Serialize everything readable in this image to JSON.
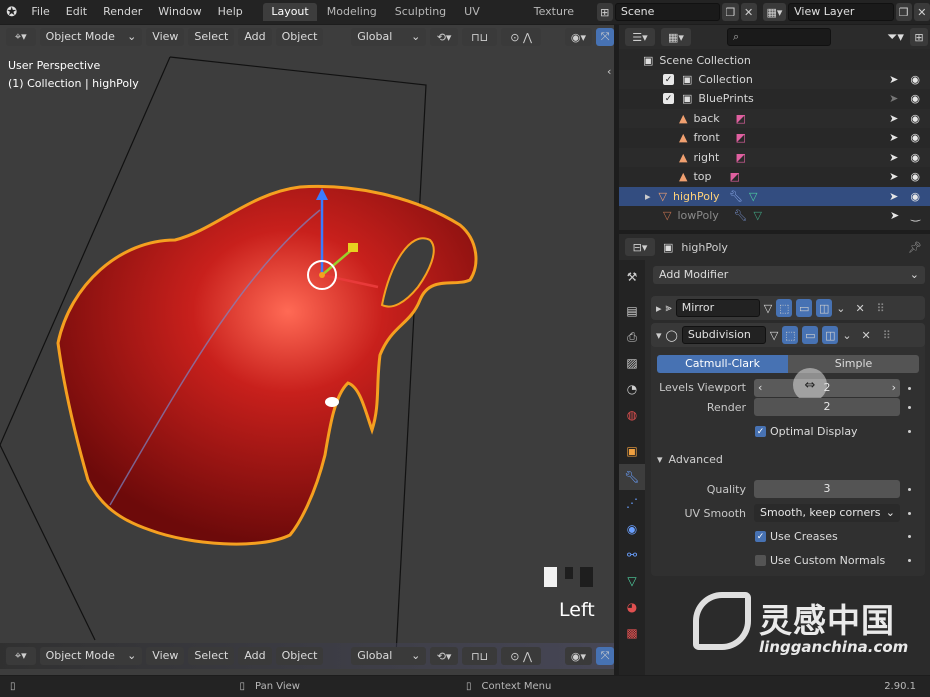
{
  "topbar": {
    "menus": [
      "File",
      "Edit",
      "Render",
      "Window",
      "Help"
    ],
    "workspaces": [
      "Layout",
      "Modeling",
      "Sculpting",
      "UV Editing",
      "Texture Pa"
    ],
    "active_workspace": "Layout",
    "scene": "Scene",
    "view_layer": "View Layer"
  },
  "viewport": {
    "mode": "Object Mode",
    "menus": [
      "View",
      "Select",
      "Add",
      "Object"
    ],
    "transform": "Global",
    "perspective": "User Perspective",
    "collection_info": "(1) Collection | highPoly",
    "view_label": "Left",
    "colors": {
      "background": "#3d3d3d",
      "car": "#b31a1a",
      "outline": "#f5a020"
    }
  },
  "outliner": {
    "search_placeholder": "",
    "root": "Scene Collection",
    "rows": [
      {
        "label": "Collection"
      },
      {
        "label": "BluePrints"
      },
      {
        "label": "back"
      },
      {
        "label": "front"
      },
      {
        "label": "right"
      },
      {
        "label": "top"
      },
      {
        "label": "highPoly"
      },
      {
        "label": "lowPoly"
      }
    ]
  },
  "properties": {
    "object_name": "highPoly",
    "add_modifier": "Add Modifier",
    "modifier1": "Mirror",
    "modifier2": "Subdivision",
    "catmull": "Catmull-Clark",
    "simple": "Simple",
    "levels_viewport_label": "Levels Viewport",
    "levels_viewport": "2",
    "render_label": "Render",
    "render": "2",
    "optimal_display": "Optimal Display",
    "advanced": "Advanced",
    "quality_label": "Quality",
    "quality": "3",
    "uv_smooth_label": "UV Smooth",
    "uv_smooth": "Smooth, keep corners",
    "use_creases": "Use Creases",
    "use_custom_normals": "Use Custom Normals",
    "accent": "#4772b3"
  },
  "statusbar": {
    "pan": "Pan View",
    "context": "Context Menu",
    "version": "2.90.1"
  },
  "watermark": {
    "brand": "灵感中国",
    "url": "lingganchina.com"
  }
}
